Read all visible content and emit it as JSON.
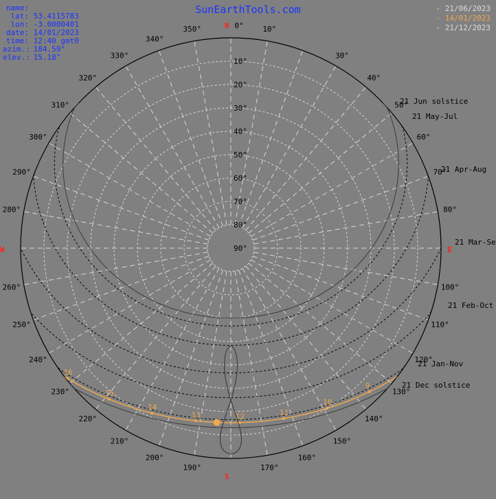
{
  "site": {
    "title": "SunEarthTools.com"
  },
  "info": [
    {
      "key": "name:",
      "value": ""
    },
    {
      "key": "lat:",
      "value": "53.4115783"
    },
    {
      "key": "lon:",
      "value": "-3.0000401"
    },
    {
      "key": "date:",
      "value": "14/01/2023"
    },
    {
      "key": "time:",
      "value": "12:40 gmt0"
    },
    {
      "key": "azim.:",
      "value": "184.59°"
    },
    {
      "key": "elev.:",
      "value": "15.18°"
    }
  ],
  "legend": [
    {
      "label": "21/06/2023",
      "color": "#dcdcdc"
    },
    {
      "label": "14/01/2023",
      "color": "#f0a850"
    },
    {
      "label": "21/12/2023",
      "color": "#dcdcdc"
    }
  ],
  "cardinals": {
    "n": "N",
    "e": "E",
    "s": "S",
    "w": "W"
  },
  "colors": {
    "accent": "#f0a850",
    "info": "#1a33ff",
    "cardinal": "#ff2020",
    "background": "#808080"
  },
  "azimuth_labels": [
    "0°",
    "10°",
    "30°",
    "40°",
    "50°",
    "60°",
    "70°",
    "80°",
    "100°",
    "110°",
    "120°",
    "130°",
    "140°",
    "150°",
    "160°",
    "170°",
    "190°",
    "200°",
    "210°",
    "220°",
    "230°",
    "240°",
    "250°",
    "260°",
    "280°",
    "290°",
    "300°",
    "310°",
    "320°",
    "330°",
    "340°",
    "350°"
  ],
  "elevation_labels": [
    "10°",
    "20°",
    "30°",
    "40°",
    "50°",
    "60°",
    "70°",
    "80°",
    "90°"
  ],
  "path_labels": [
    "21 Jun  solstice",
    "21 May-Jul",
    "21 Apr-Aug",
    "21 Mar-Sep",
    "21 Feb-Oct",
    "21 Jan-Nov",
    "21 Dec  solstice"
  ],
  "hour_labels": [
    "16",
    "15",
    "14",
    "13",
    "12",
    "11",
    "10",
    "9"
  ],
  "sun_position": {
    "azimuth_deg": 184.59,
    "elevation_deg": 15.18
  }
}
